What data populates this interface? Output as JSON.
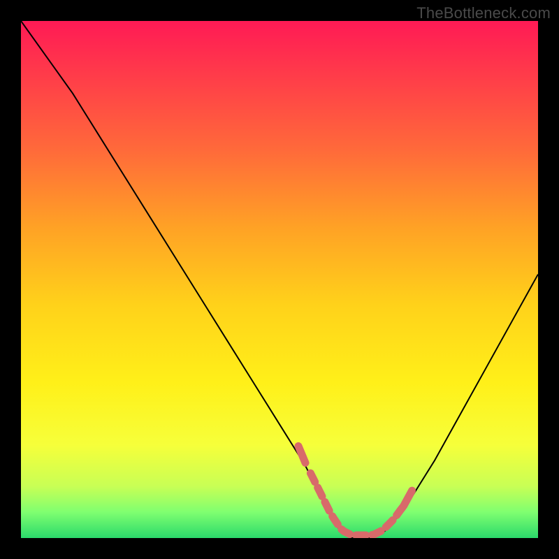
{
  "watermark": "TheBottleneck.com",
  "chart_data": {
    "type": "line",
    "title": "",
    "xlabel": "",
    "ylabel": "",
    "xlim": [
      0,
      100
    ],
    "ylim": [
      0,
      100
    ],
    "series": [
      {
        "name": "curve",
        "x": [
          0,
          5,
          10,
          15,
          20,
          25,
          30,
          35,
          40,
          45,
          50,
          55,
          58,
          60,
          62,
          64,
          66,
          68,
          70,
          72,
          75,
          80,
          85,
          90,
          95,
          100
        ],
        "y": [
          100,
          93,
          86,
          78,
          70,
          62,
          54,
          46,
          38,
          30,
          22,
          14,
          8,
          4,
          1,
          0,
          0,
          0,
          1,
          3,
          7,
          15,
          24,
          33,
          42,
          51
        ]
      },
      {
        "name": "highlight-band",
        "x": [
          56,
          74
        ],
        "y": [
          0,
          0
        ]
      }
    ],
    "gradient_stops": [
      {
        "offset": 0.0,
        "color": "#ff1a55"
      },
      {
        "offset": 0.1,
        "color": "#ff3a4a"
      },
      {
        "offset": 0.25,
        "color": "#ff6a3a"
      },
      {
        "offset": 0.4,
        "color": "#ffa225"
      },
      {
        "offset": 0.55,
        "color": "#ffd21a"
      },
      {
        "offset": 0.7,
        "color": "#fff019"
      },
      {
        "offset": 0.82,
        "color": "#f6ff3a"
      },
      {
        "offset": 0.9,
        "color": "#c8ff55"
      },
      {
        "offset": 0.95,
        "color": "#7fff70"
      },
      {
        "offset": 1.0,
        "color": "#2bd96b"
      }
    ],
    "curve_color": "#000000",
    "highlight_color": "#d86a6a"
  }
}
